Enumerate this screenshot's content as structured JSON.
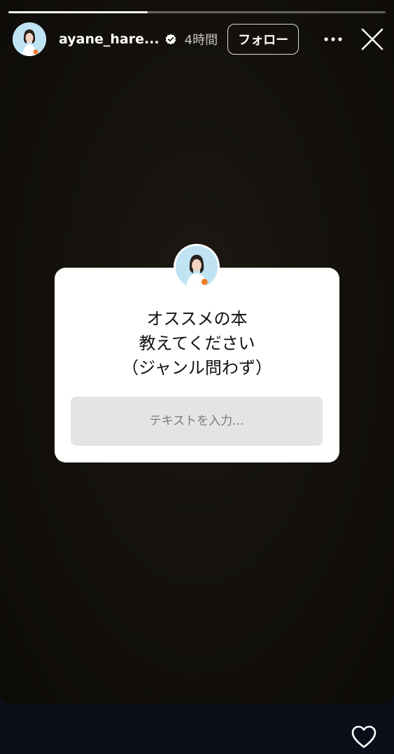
{
  "story": {
    "progress": 0.37,
    "username": "ayane_hare...",
    "verified_icon": "verified-badge-icon",
    "time_ago": "4時間",
    "follow_label": "フォロー",
    "more_icon": "more-dots-icon",
    "close_icon": "close-icon"
  },
  "question_sticker": {
    "question": "オススメの本\n教えてください\n（ジャンル問わず）",
    "input_placeholder": "テキストを入力..."
  },
  "footer": {
    "like_icon": "heart-icon"
  }
}
